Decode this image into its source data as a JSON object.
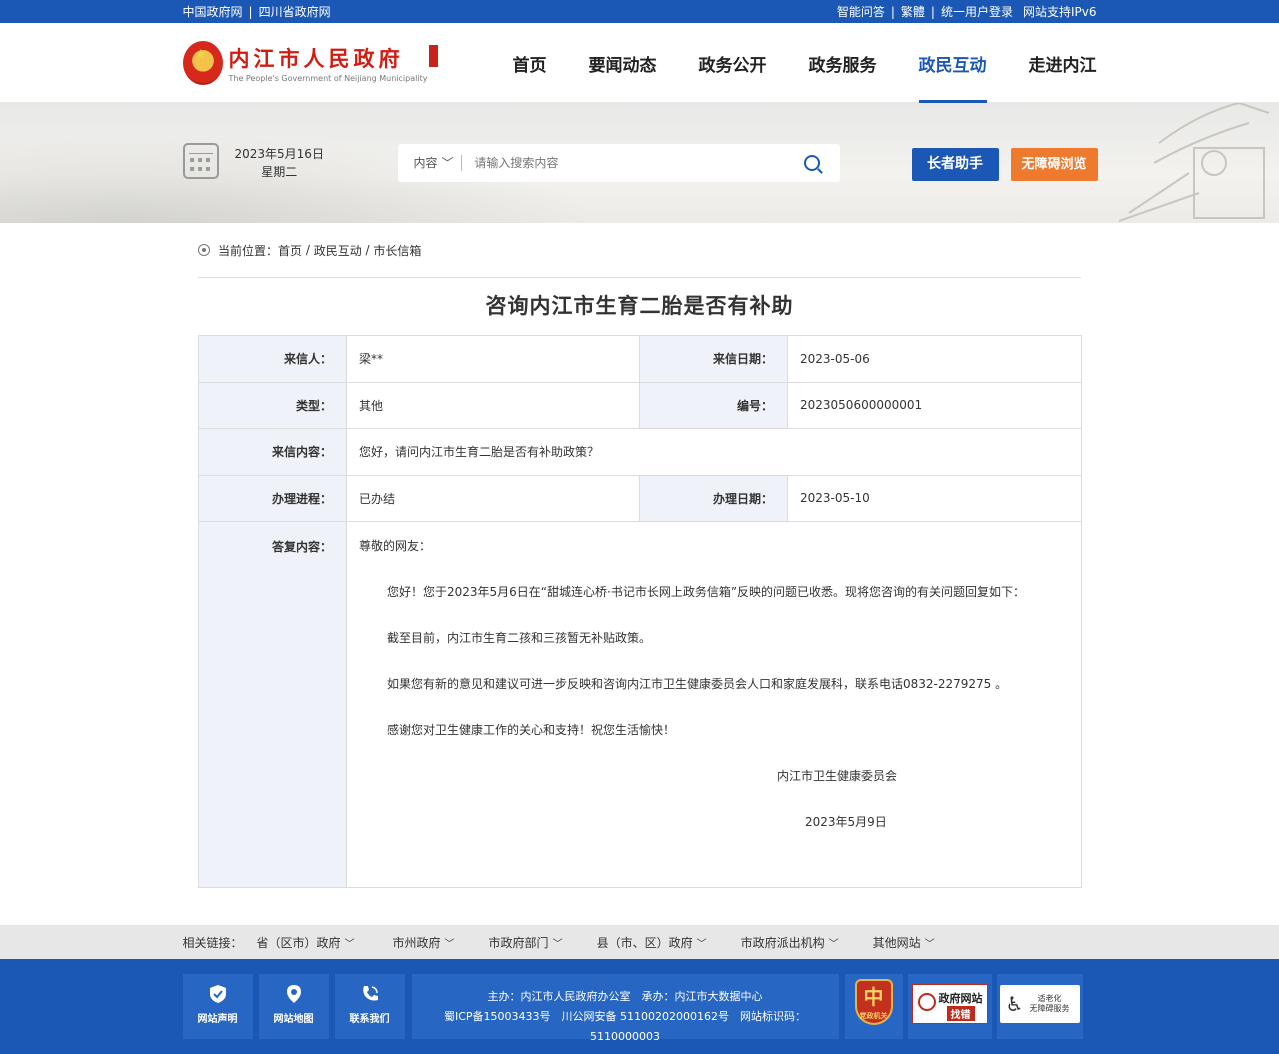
{
  "topbar": {
    "left_links": [
      "中国政府网",
      "四川省政府网"
    ],
    "right_links": [
      "智能问答",
      "繁體",
      "统一用户登录",
      "网站支持IPv6"
    ]
  },
  "header": {
    "logo_cn": "内江市人民政府",
    "logo_en": "The People's Government of Neijiang Municipality",
    "nav": [
      "首页",
      "要闻动态",
      "政务公开",
      "政务服务",
      "政民互动",
      "走进内江"
    ],
    "active_nav": "政民互动"
  },
  "band": {
    "date": "2023年5月16日",
    "weekday": "星期二",
    "search_scope": "内容",
    "search_placeholder": "请输入搜索内容",
    "elder_btn": "长者助手",
    "access_btn": "无障碍浏览"
  },
  "breadcrumb": {
    "label": "当前位置：",
    "items": [
      "首页",
      "政民互动",
      "市长信箱"
    ]
  },
  "letter": {
    "title": "咨询内江市生育二胎是否有补助",
    "sender_label": "来信人：",
    "sender": "梁**",
    "date_label": "来信日期：",
    "date": "2023-05-06",
    "type_label": "类型：",
    "type": "其他",
    "number_label": "编号：",
    "number": "2023050600000001",
    "content_label": "来信内容：",
    "content": "您好，请问内江市生育二胎是否有补助政策？",
    "progress_label": "办理进程：",
    "progress": "已办结",
    "handle_date_label": "办理日期：",
    "handle_date": "2023-05-10",
    "reply_label": "答复内容：",
    "reply": {
      "greeting": "尊敬的网友：",
      "p1": "您好！您于2023年5月6日在“甜城连心桥·书记市长网上政务信箱”反映的问题已收悉。现将您咨询的有关问题回复如下：",
      "p2": "截至目前，内江市生育二孩和三孩暂无补贴政策。",
      "p3": "如果您有新的意见和建议可进一步反映和咨询内江市卫生健康委员会人口和家庭发展科，联系电话0832-2279275 。",
      "p4": "感谢您对卫生健康工作的关心和支持！祝您生活愉快！",
      "signer": "内江市卫生健康委员会",
      "sign_date": "2023年5月9日"
    }
  },
  "related_links": {
    "label": "相关链接：",
    "items": [
      "省（区市）政府",
      "市州政府",
      "市政府部门",
      "县（市、区）政府",
      "市政府派出机构",
      "其他网站"
    ]
  },
  "footer": {
    "boxes": [
      "网站声明",
      "网站地图",
      "联系我们"
    ],
    "sponsor": "主办：内江市人民政府办公室　承办：内江市大数据中心",
    "icp": "蜀ICP备15003433号　川公网安备 51100202000162号　网站标识码：5110000003",
    "badge_party_small": "党政机关",
    "badge_party_char": "中",
    "badge_error_t1": "政府网站",
    "badge_error_t2": "找错",
    "badge_elder_t": "适老化\n无障碍服务"
  }
}
